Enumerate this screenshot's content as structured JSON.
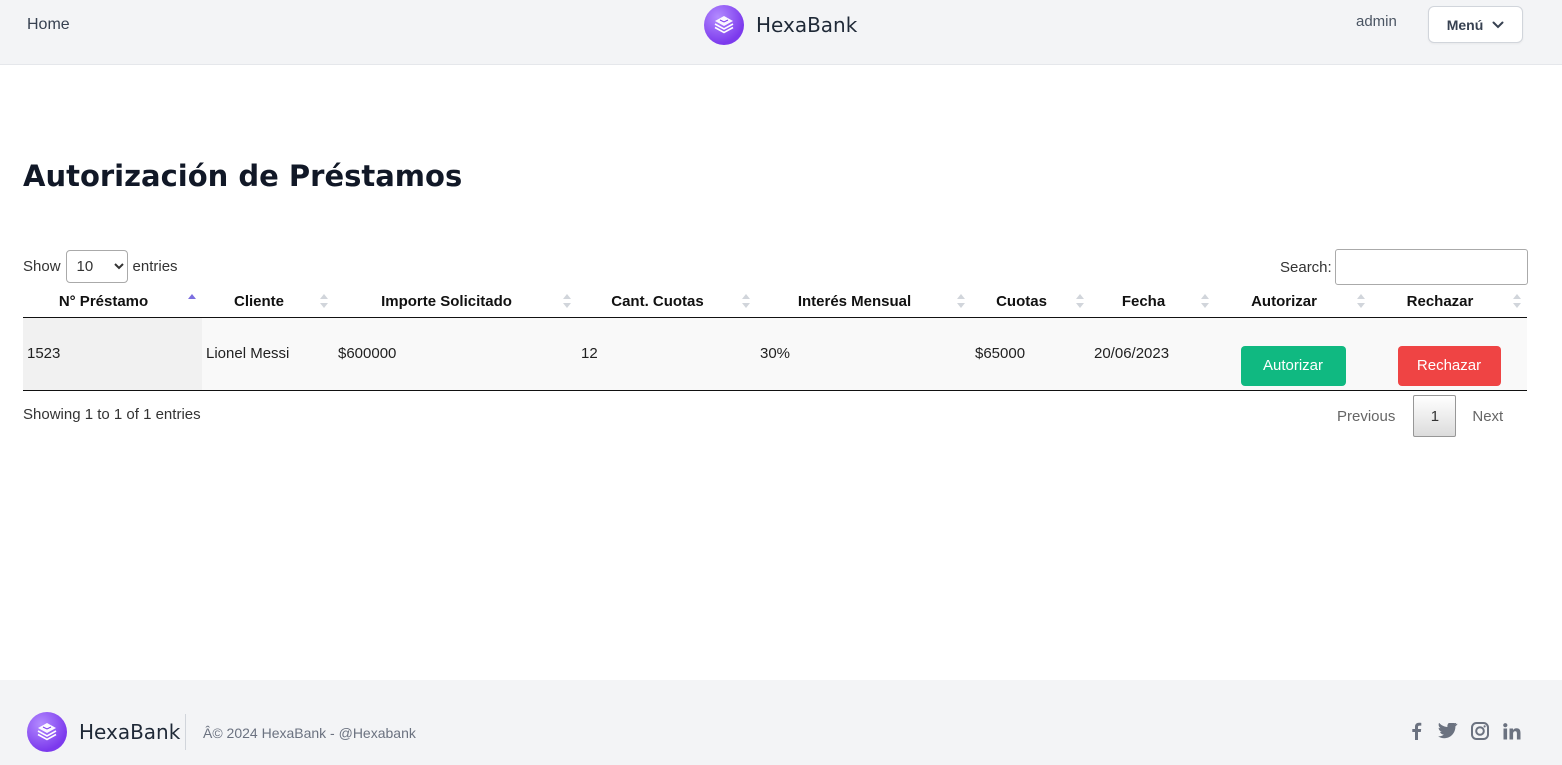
{
  "nav": {
    "home": "Home",
    "brand": "HexaBank",
    "user": "admin",
    "menu": "Menú"
  },
  "page": {
    "title": "Autorización de Préstamos"
  },
  "controls": {
    "show_label": "Show",
    "entries_value": "10",
    "entries_label": "entries",
    "search_label": "Search:",
    "search_value": ""
  },
  "table": {
    "columns": [
      "N° Préstamo",
      "Cliente",
      "Importe Solicitado",
      "Cant. Cuotas",
      "Interés Mensual",
      "Cuotas",
      "Fecha",
      "Autorizar",
      "Rechazar"
    ],
    "rows": [
      {
        "numero": "1523",
        "cliente": "Lionel Messi",
        "importe": "$600000",
        "cant_cuotas": "12",
        "interes": "30%",
        "cuotas": "$65000",
        "fecha": "20/06/2023",
        "autorizar": "Autorizar",
        "rechazar": "Rechazar"
      }
    ]
  },
  "footer_info": {
    "showing": "Showing 1 to 1 of 1 entries",
    "previous": "Previous",
    "page": "1",
    "next": "Next"
  },
  "footer": {
    "brand": "HexaBank",
    "copyright": "Â© 2024 HexaBank  - @Hexabank",
    "social": [
      "facebook-icon",
      "twitter-icon",
      "instagram-icon",
      "linkedin-icon"
    ]
  },
  "colors": {
    "accent": "#7c3aed",
    "authorize": "#10b981",
    "reject": "#ef4444"
  }
}
